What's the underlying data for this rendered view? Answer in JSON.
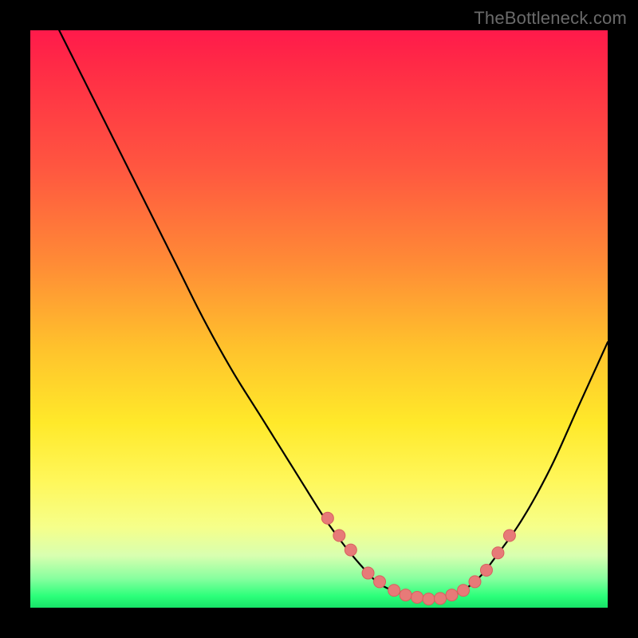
{
  "watermark": "TheBottleneck.com",
  "colors": {
    "background": "#000000",
    "curve": "#000000",
    "marker_fill": "#e77a78",
    "marker_stroke": "#d85f5e"
  },
  "chart_data": {
    "type": "line",
    "title": "",
    "xlabel": "",
    "ylabel": "",
    "xlim": [
      0,
      100
    ],
    "ylim": [
      0,
      100
    ],
    "x": [
      5,
      10,
      15,
      20,
      25,
      30,
      35,
      40,
      45,
      50,
      52,
      55,
      58,
      60,
      62,
      65,
      68,
      70,
      72,
      75,
      78,
      80,
      85,
      90,
      95,
      100
    ],
    "values": [
      100,
      90,
      80,
      70,
      60,
      50,
      41,
      33,
      25,
      17,
      14,
      10,
      6.5,
      4.5,
      3.3,
      2.2,
      1.6,
      1.5,
      1.8,
      3.0,
      5.5,
      8,
      15,
      24,
      35,
      46
    ],
    "markers": {
      "x": [
        51.5,
        53.5,
        55.5,
        58.5,
        60.5,
        63,
        65,
        67,
        69,
        71,
        73,
        75,
        77,
        79,
        81,
        83
      ],
      "y": [
        15.5,
        12.5,
        10.0,
        6.0,
        4.5,
        3.0,
        2.2,
        1.8,
        1.5,
        1.6,
        2.2,
        3.0,
        4.5,
        6.5,
        9.5,
        12.5
      ]
    }
  }
}
